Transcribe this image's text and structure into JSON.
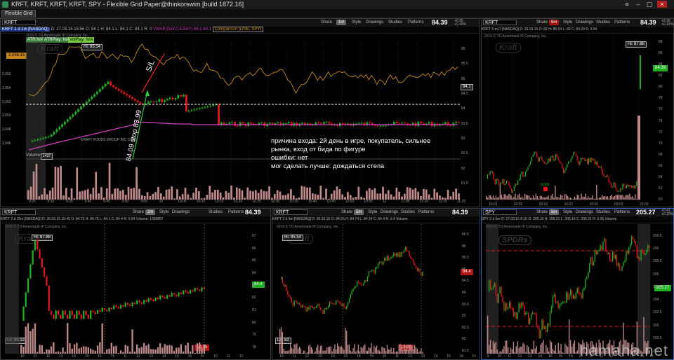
{
  "window": {
    "title": "KRFT, KRFT, KRFT, KRFT, SPY - Flexible Grid Paper@thinkorswim [build 1872.16]",
    "tab": "Flexible Grid"
  },
  "toolbar": {
    "share": "Share",
    "style": "Style",
    "drawings": "Drawings",
    "studies": "Studies",
    "patterns": "Patterns"
  },
  "panels": {
    "main": {
      "symbol": "KRFT",
      "timeframe": "1m",
      "price": "84.39",
      "change": "+0.36 +0.43%",
      "header": {
        "ticker": "KRFT 1 d 1m [NASDAQ]",
        "date": "D: 27.03.15 15:56",
        "o": "O: 84.1",
        "h": "H: 84.1",
        "l": "L: 84.1",
        "c": "C: 84.1",
        "r": "R: 0",
        "vwap": "VWAP(DAY,0.5,DAY)",
        "vwap_v1": "84.1",
        "vwap_v2": "84.1",
        "comparison": "Comparison (LINE, SPY)"
      },
      "copyright": "2015 © TD Ameritrade IP Company, Inc.",
      "indicators": {
        "atr": "ATR:N/A",
        "atrplay": "ATRPlay: N/A",
        "volplay": "VolPlay: N/A"
      },
      "hi_label": "Hi: 85.54",
      "kraft_logo": "Kraft",
      "line_price": "84.1",
      "left_price": "2,056.15",
      "volume_label": "Volume",
      "volume_value": "1437",
      "company": "KRAFT FOODS GROUP INC COM",
      "annotations": {
        "sl": "S/L",
        "stop": "84.09 stop 83.99"
      },
      "note": [
        "причина входа: 2й день в игре, покупатель, сильнее",
        "рынка, вход от бида по фигуре",
        "ошибки: нет",
        "мог сделать лучше: дождаться степа"
      ],
      "y_left": [
        "2,056",
        "2,054",
        "2,052",
        "2,050",
        "2,048",
        "2,046"
      ],
      "y_right": [
        "86",
        "85.5",
        "85",
        "84.5",
        "84",
        "83.5",
        "83",
        "82.5",
        "82",
        "81.5"
      ],
      "x_labels": [
        "9:25",
        "9:30",
        "9:35",
        "9:40",
        "9:45",
        "9:50",
        "9:55",
        "10",
        "10:05",
        "10:10",
        "10:15",
        "10:20",
        "10:25",
        "10:30",
        "10:35",
        "10:40",
        "10:45",
        "10:50",
        "10:55",
        "11",
        "11:05",
        "11:10",
        "11:15",
        "11:20"
      ]
    },
    "tr": {
      "symbol": "KRFT",
      "timeframe": "5m",
      "price": "84.39",
      "change": "+0.36 +0.43%",
      "header": "KRFT 5 m D [NASDAQ]  D: 26.03.15  O: 82  H: 85.54  L: 82  C: 84.39  R: 3.54",
      "copyright": "2015 © TD Ameritrade IP Company, Inc.",
      "kraft_logo": "Kraft",
      "hi_label": "Hi: 87.88",
      "last": "84.39",
      "dot_label": "0.069",
      "y": [
        "88",
        "86",
        "84",
        "82",
        "80",
        "78",
        "76",
        "74",
        "72",
        "70",
        "68",
        "66",
        "64",
        "62",
        "60"
      ],
      "x": [
        "16:01",
        "02:02",
        "03:03",
        "16:02",
        "16:03",
        "03:03",
        "23:03"
      ]
    },
    "bl": {
      "symbol": "KRFT",
      "timeframe": "2m",
      "price": "84.39",
      "change": "+0.36 +0.43%",
      "header": "KRFT 2 d 15m [NASDAQ]  D: 26.03.15 15:45  O: 84.75  H: 84.75  L: 84.1  C: 84.4  R: 0.64  Volume: 1399857",
      "copyright": "2015 © TD Ameritrade IP Company, Inc.",
      "kraft_logo": "Kraft",
      "hi_label": "Hi: 87.88",
      "lo_label": "Lo: 80.12",
      "last": "84.4",
      "time_box": "15:15",
      "y": [
        "87",
        "86",
        "85",
        "84",
        "83",
        "82",
        "81",
        "80",
        "79",
        "78"
      ],
      "x": [
        "10",
        "11",
        "12",
        "13",
        "14",
        "15",
        "16",
        "Th",
        "11",
        "12",
        "13",
        "14",
        "15",
        "16",
        "Fr",
        "10",
        "11",
        "12"
      ]
    },
    "bm": {
      "symbol": "KRFT",
      "timeframe": "5m",
      "price": "84.39",
      "change": "+0.36 +0.43%",
      "header": "KRFT 2 d 5m [NASDAQ]  D: 26.03.15  O: 84.55  H: 84.74  L: 84.34  C: 84.4  R: 0.4  Volume",
      "copyright": "2015 © TD Ameritrade IP Company, Inc.",
      "kraft_logo": "Kraft",
      "hi_label": "Hi: 85.54",
      "lo_label": "Lo: 82",
      "last": "84.4",
      "time_box": "15:00",
      "y": [
        "86.5",
        "86",
        "85.5",
        "85",
        "84.5",
        "84",
        "83.5",
        "83",
        "82.5",
        "82",
        "81.5"
      ],
      "x": [
        "10",
        "11",
        "12",
        "13",
        "14",
        "15",
        "16",
        "Th",
        "10",
        "11",
        "12",
        "13",
        "14",
        "15",
        "16",
        "Fr"
      ]
    },
    "br": {
      "symbol": "SPY",
      "timeframe": "5m",
      "price": "205.27",
      "change": "+0.41 +0.20%",
      "header": "SPY 2 d 5m  D: 27.03.15 8:10  O: 205.19  H: 205.21  L: 205.16  C: 205.21  R: 0.05  Volume",
      "copyright": "2015 © TD Ameritrade IP Company, Inc.",
      "logo": "SPDRs",
      "last": "205.27",
      "y": [
        "206.5",
        "206",
        "205.5",
        "205",
        "204.5",
        "204",
        "203.5",
        "203",
        "202.5",
        "202"
      ],
      "x": [
        "9",
        "10",
        "11",
        "12",
        "13",
        "14",
        "15",
        "16",
        "Th",
        "10",
        "11",
        "12",
        "13",
        "14",
        "15",
        "16",
        "Fr"
      ]
    }
  },
  "watermark": "hamaha.net",
  "colors": {
    "up": "#1fb01f",
    "down": "#e01818",
    "vwap": "#d040c0",
    "comparison": "#d99a1c",
    "volume": "#c08a8a",
    "accent": "#2b68b7"
  }
}
